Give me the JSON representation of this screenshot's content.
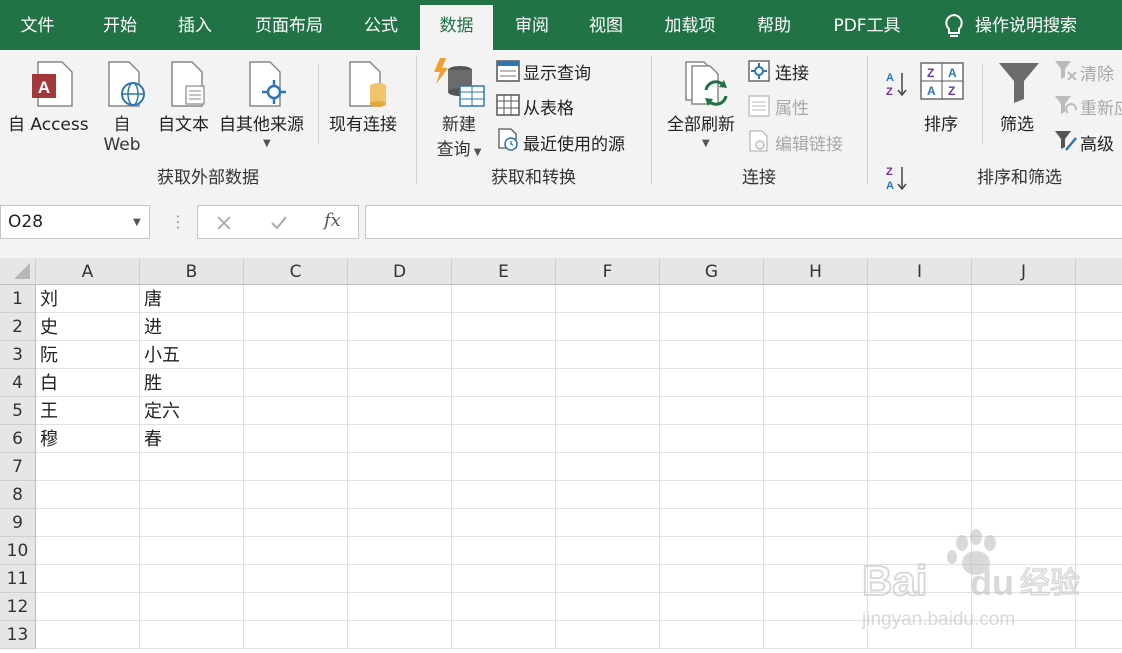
{
  "menu_tabs": [
    "文件",
    "开始",
    "插入",
    "页面布局",
    "公式",
    "数据",
    "审阅",
    "视图",
    "加载项",
    "帮助",
    "PDF工具"
  ],
  "tell_me": "操作说明搜索",
  "ribbon": {
    "from_access": "自 Access",
    "from_web": [
      "自",
      "Web"
    ],
    "from_text": "自文本",
    "from_other": "自其他来源",
    "existing": "现有连接",
    "group_external": "获取外部数据",
    "new_query": [
      "新建",
      "查询"
    ],
    "show_queries": "显示查询",
    "from_table": "从表格",
    "recent_sources": "最近使用的源",
    "group_transform": "获取和转换",
    "refresh_all": "全部刷新",
    "connections": "连接",
    "properties": "属性",
    "edit_links": "编辑链接",
    "group_connections": "连接",
    "sort": "排序",
    "filter": "筛选",
    "clear": "清除",
    "reapply": "重新应",
    "advanced": "高级",
    "group_sort": "排序和筛选"
  },
  "formula_bar": {
    "name_box": "O28",
    "fx": "fx",
    "value": ""
  },
  "columns": [
    "A",
    "B",
    "C",
    "D",
    "E",
    "F",
    "G",
    "H",
    "I",
    "J"
  ],
  "rows": [
    "1",
    "2",
    "3",
    "4",
    "5",
    "6",
    "7",
    "8",
    "9",
    "10",
    "11",
    "12",
    "13"
  ],
  "cells": [
    [
      "刘",
      "唐"
    ],
    [
      "史",
      "进"
    ],
    [
      "阮",
      "小五"
    ],
    [
      "白",
      "胜"
    ],
    [
      "王",
      "定六"
    ],
    [
      "穆",
      "春"
    ]
  ],
  "watermark": {
    "brand": "Baidu",
    "sub": "经验",
    "url": "jingyan.baidu.com"
  },
  "colors": {
    "excel_green": "#217346",
    "ribbon_bg": "#f3f3f3",
    "header_bg": "#e6e6e6"
  }
}
